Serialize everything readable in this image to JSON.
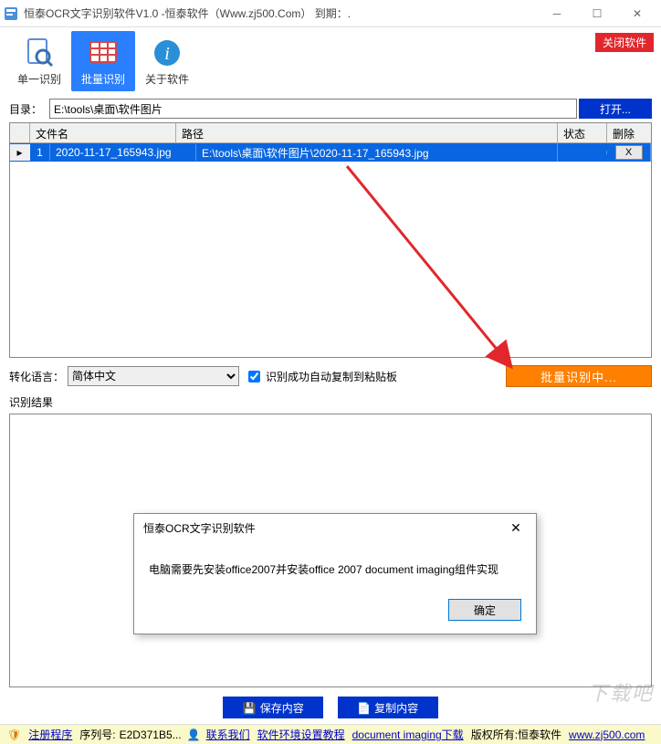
{
  "window": {
    "title": "恒泰OCR文字识别软件V1.0 -恒泰软件（Www.zj500.Com） 到期：."
  },
  "toolbar": {
    "single_label": "单一识别",
    "batch_label": "批量识别",
    "about_label": "关于软件",
    "close_soft": "关闭软件"
  },
  "dir": {
    "label": "目录：",
    "value": "E:\\tools\\桌面\\软件图片",
    "open_btn": "打开..."
  },
  "grid": {
    "headers": {
      "fname": "文件名",
      "path": "路径",
      "state": "状态",
      "del": "删除"
    },
    "rows": [
      {
        "num": "1",
        "fname": "2020-11-17_165943.jpg",
        "path": "E:\\tools\\桌面\\软件图片\\2020-11-17_165943.jpg",
        "state": "",
        "del": "X"
      }
    ]
  },
  "lang": {
    "label": "转化语言：",
    "value": "简体中文",
    "auto_copy": "识别成功自动复制到粘贴板",
    "batch_btn": "批量识别中..."
  },
  "result": {
    "label": "识别结果"
  },
  "dialog": {
    "title": "恒泰OCR文字识别软件",
    "body": "电脑需要先安装office2007并安装office 2007 document imaging组件实现",
    "ok": "确定"
  },
  "bottom": {
    "save": "保存内容",
    "copy": "复制内容"
  },
  "status": {
    "register": "注册程序",
    "serial_label": "序列号:",
    "serial": "E2D371B5...",
    "contact": "联系我们",
    "env": "软件环境设置教程",
    "docimg": "document imaging下载",
    "owner_label": "版权所有:恒泰软件",
    "url": "www.zj500.com"
  },
  "watermark": "下载吧"
}
